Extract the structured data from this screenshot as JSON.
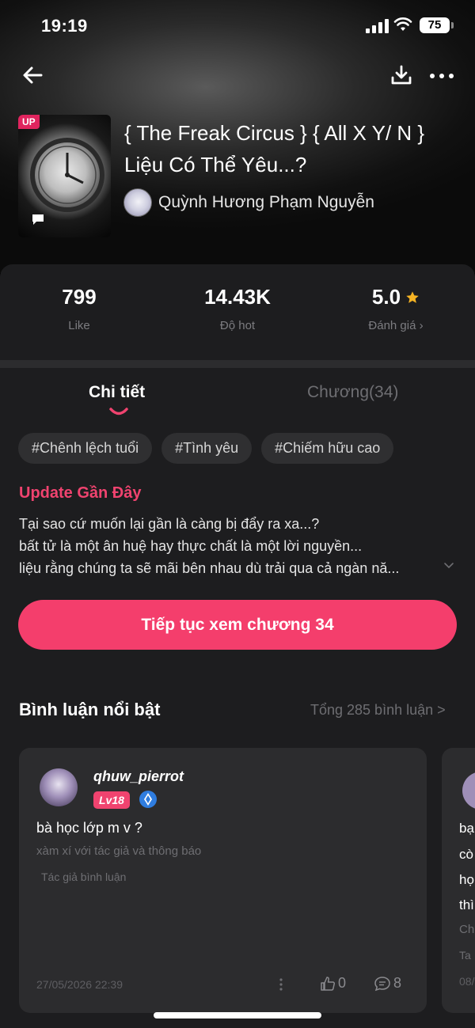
{
  "status": {
    "time": "19:19",
    "battery": "75"
  },
  "book": {
    "badge": "UP",
    "title": "{ The Freak Circus } { All X Y/ N } Liệu Có Thể Yêu...?",
    "author": "Quỳnh Hương Phạm Nguyễn"
  },
  "stats": [
    {
      "value": "799",
      "label": "Like"
    },
    {
      "value": "14.43K",
      "label": "Độ hot"
    },
    {
      "value": "5.0",
      "label": "Đánh giá ›"
    }
  ],
  "tabs": {
    "detail": "Chi tiết",
    "chapters": "Chương(34)"
  },
  "tags": [
    "#Chênh lệch tuổi",
    "#Tình yêu",
    "#Chiếm hữu cao"
  ],
  "update": {
    "title": "Update Gần Đây",
    "lines": [
      "Tại sao cứ muốn lại gần là càng bị đẩy ra xa...?",
      "bất tử là một ân huệ hay thực chất là một lời nguyền...",
      "liệu rằng chúng ta sẽ mãi bên nhau dù trải qua cả ngàn nă..."
    ]
  },
  "cta": "Tiếp tục xem chương 34",
  "comments": {
    "title": "Bình luận nổi bật",
    "total": "Tổng 285 bình luận >",
    "items": [
      {
        "user": "qhuw_pierrot",
        "level": "Lv18",
        "text": "bà học lớp m v ?",
        "sub": "xàm xí với tác giả và thông báo",
        "author_tag": "Tác giả bình luận",
        "date": "27/05/2026 22:39",
        "likes": "0",
        "replies": "8"
      }
    ],
    "partial_lines": [
      "bạ",
      "cò",
      "họ",
      "thì",
      "Ch",
      "Ta",
      "08/"
    ]
  },
  "colors": {
    "accent": "#f43e6c",
    "panel": "#1d1d1f",
    "card": "#2c2c2e"
  },
  "icons": [
    "back-arrow-icon",
    "download-icon",
    "more-icon",
    "star-icon",
    "chat-bubble-icon",
    "rank-diamond-icon",
    "thumb-up-icon",
    "comment-icon"
  ]
}
